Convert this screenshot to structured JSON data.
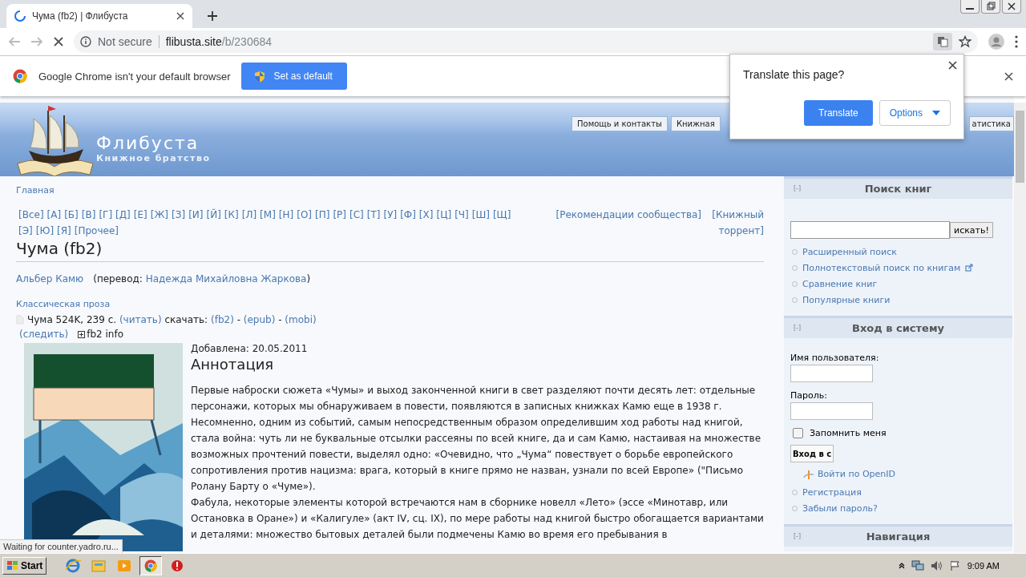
{
  "browser": {
    "tab_title": "Чума (fb2) | Флибуста",
    "url_security": "Not secure",
    "url_host": "flibusta.site",
    "url_path": "/b/230684"
  },
  "infobar": {
    "message": "Google Chrome isn't your default browser",
    "button": "Set as default"
  },
  "translate_popup": {
    "title": "Translate this page?",
    "translate_button": "Translate",
    "options_button": "Options"
  },
  "site": {
    "title": "Флибуста",
    "subtitle": "Книжное братство",
    "tabs": [
      "Помощь и контакты",
      "Книжная",
      "атистика"
    ]
  },
  "breadcrumb": "Главная",
  "letters": [
    "[Все]",
    "[А]",
    "[Б]",
    "[В]",
    "[Г]",
    "[Д]",
    "[Е]",
    "[Ж]",
    "[З]",
    "[И]",
    "[Й]",
    "[К]",
    "[Л]",
    "[М]",
    "[Н]",
    "[О]",
    "[П]",
    "[Р]",
    "[С]",
    "[Т]",
    "[У]",
    "[Ф]",
    "[Х]",
    "[Ц]",
    "[Ч]",
    "[Ш]",
    "[Щ]",
    "[Э]",
    "[Ю]",
    "[Я]",
    "[Прочее]"
  ],
  "side_links": [
    "[Рекомендации сообщества]",
    "[Книжный торрент]"
  ],
  "book": {
    "title": "Чума (fb2)",
    "author": "Альбер Камю",
    "translator_prefix": "(перевод: ",
    "translator": "Надежда Михайловна Жаркова",
    "translator_suffix": ")",
    "genre": "Классическая проза",
    "file_info": "Чума 524K, 239 с. ",
    "read_link": "(читать)",
    "download_label": " скачать: ",
    "formats": [
      "(fb2)",
      "(epub)",
      "(mobi)"
    ],
    "format_separator": " - ",
    "follow_link": "(следить)",
    "fb2_info": "fb2 info",
    "added": "Добавлена: 20.05.2011",
    "annotation_title": "Аннотация",
    "paragraphs": [
      "Первые наброски сюжета «Чумы» и выход законченной книги в свет разделяют почти десять лет: отдельные персонажи, которых мы обнаруживаем в повести, появляются в записных книжках Камю еще в 1938 г. Несомненно, одним из событий, самым непосредственным образом определившим ход работы над книгой, стала война: чуть ли не буквальные отсылки рассеяны по всей книге, да и сам Камю, настаивая на множестве возможных прочтений повести, выделял одно: «Очевидно, что „Чума“ повествует о борьбе европейского сопротивления против нацизма: врага, который в книге прямо не назван, узнали по всей Европе» (\"Письмо Ролану Барту о «Чуме»).",
      "Фабула, некоторые элементы которой встречаются нам в сборнике новелл «Лето» (эссе «Минотавр, или Остановка в Оране») и «Калигуле» (акт IV, сц. IX), по мере работы над книгой быстро обогащается вариантами и деталями: множество бытовых деталей были подмечены Камю во время его пребывания в"
    ]
  },
  "sidebar": {
    "search": {
      "collapse": "[-]",
      "title": "Поиск книг",
      "button": "искать!",
      "links": [
        {
          "label": "Расширенный поиск",
          "external": false
        },
        {
          "label": "Полнотекстовый поиск по книгам",
          "external": true
        },
        {
          "label": "Сравнение книг",
          "external": false
        },
        {
          "label": "Популярные книги",
          "external": false
        }
      ]
    },
    "login": {
      "collapse": "[-]",
      "title": "Вход в систему",
      "username_label": "Имя пользователя:",
      "password_label": "Пароль:",
      "remember": {
        "label": "Запомнить меня",
        "checked": false
      },
      "button": "Вход в с",
      "openid": "Войти по OpenID",
      "links": [
        "Регистрация",
        "Забыли пароль?"
      ]
    },
    "navigation": {
      "collapse": "[-]",
      "title": "Навигация"
    }
  },
  "status": "Waiting for counter.yadro.ru...",
  "taskbar": {
    "start": "Start",
    "clock": "9:09 AM"
  }
}
